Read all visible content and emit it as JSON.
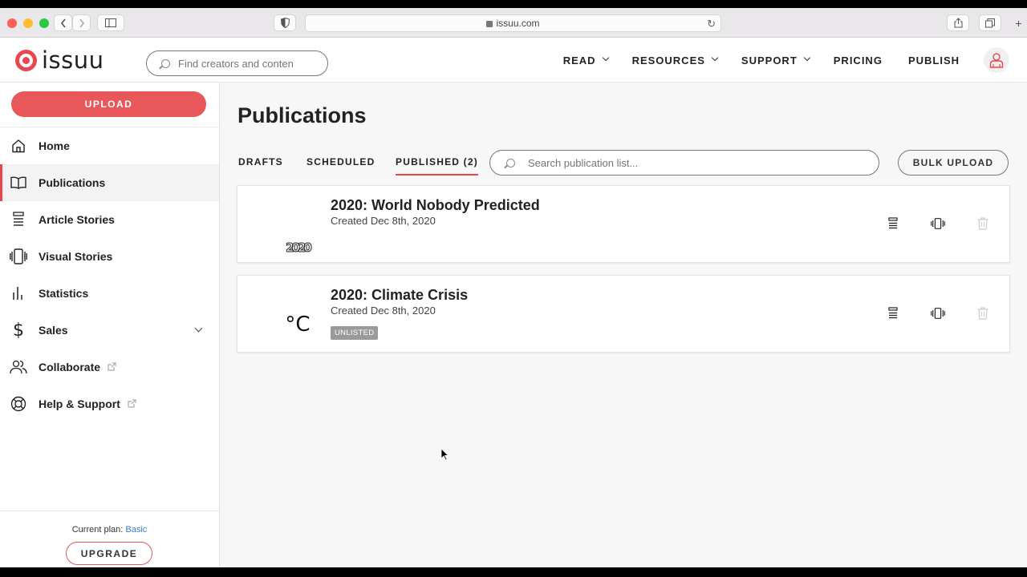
{
  "browser": {
    "url": "issuu.com"
  },
  "header": {
    "logo_text": "issuu",
    "search_placeholder": "Find creators and conten",
    "nav": [
      {
        "label": "READ"
      },
      {
        "label": "RESOURCES"
      },
      {
        "label": "SUPPORT"
      },
      {
        "label": "PRICING"
      },
      {
        "label": "PUBLISH"
      }
    ]
  },
  "sidebar": {
    "upload_label": "UPLOAD",
    "items": [
      {
        "label": "Home",
        "icon": "home-icon"
      },
      {
        "label": "Publications",
        "icon": "book-icon",
        "active": true
      },
      {
        "label": "Article Stories",
        "icon": "article-icon"
      },
      {
        "label": "Visual Stories",
        "icon": "visual-stories-icon"
      },
      {
        "label": "Statistics",
        "icon": "bar-chart-icon"
      },
      {
        "label": "Sales",
        "icon": "dollar-icon"
      },
      {
        "label": "Collaborate",
        "icon": "users-icon"
      },
      {
        "label": "Help & Support",
        "icon": "lifebuoy-icon"
      }
    ],
    "plan_prefix": "Current plan:",
    "plan_name": "Basic",
    "upgrade_label": "UPGRADE"
  },
  "main": {
    "title": "Publications",
    "tabs": [
      {
        "label": "DRAFTS"
      },
      {
        "label": "SCHEDULED"
      },
      {
        "label": "PUBLISHED (2)",
        "active": true
      }
    ],
    "search_placeholder": "Search publication list...",
    "bulk_upload_label": "BULK UPLOAD",
    "publications": [
      {
        "title": "2020: World Nobody Predicted",
        "created": "Created Dec 8th, 2020",
        "thumb_text": "2020",
        "badge": ""
      },
      {
        "title": "2020: Climate Crisis",
        "created": "Created Dec 8th, 2020",
        "thumb_text": "°C",
        "badge": "UNLISTED"
      }
    ]
  },
  "colors": {
    "accent": "#e8474f",
    "link": "#3a7bd5"
  }
}
